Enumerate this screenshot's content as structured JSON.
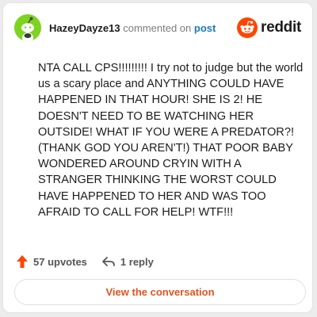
{
  "header": {
    "username": "HazeyDayze13",
    "verb": "commented on",
    "target": "post",
    "brand": "reddit"
  },
  "comment": {
    "text": "NTA CALL CPS!!!!!!!!! I try not to judge but the world us a scary place and ANYTHING COULD HAVE HAPPENED IN THAT HOUR! SHE IS 2! HE DOESN'T NEED TO BE WATCHING HER OUTSIDE! WHAT IF YOU WERE A PREDATOR?! (THANK GOD YOU AREN'T!) THAT POOR BABY WONDERED AROUND CRYIN WITH A STRANGER THINKING THE WORST COULD HAVE HAPPENED TO HER AND WAS TOO AFRAID TO CALL FOR HELP! WTF!!!"
  },
  "actions": {
    "upvotes": "57 upvotes",
    "replies": "1 reply"
  },
  "cta": {
    "label": "View the conversation"
  },
  "colors": {
    "accent": "#ff4500",
    "link": "#1a7ab8",
    "avatar": "#7ed321"
  },
  "icons": {
    "avatar": "snoo-avatar-icon",
    "brand": "reddit-logo-icon",
    "upvote": "upvote-arrow-icon",
    "reply": "reply-arrow-icon"
  }
}
